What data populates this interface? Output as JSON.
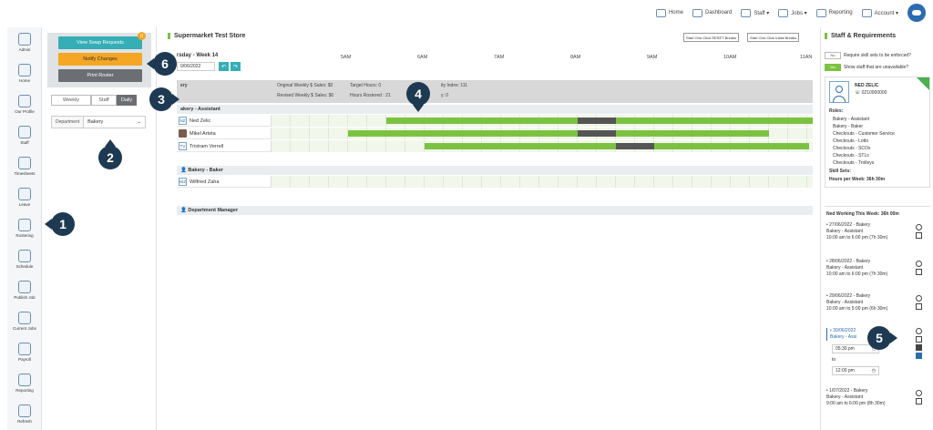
{
  "topnav": {
    "items": [
      {
        "label": "Home",
        "icon": "home-icon"
      },
      {
        "label": "Dashboard",
        "icon": "dashboard-icon"
      },
      {
        "label": "Staff ▾",
        "icon": "staff-icon"
      },
      {
        "label": "Jobs ▾",
        "icon": "jobs-icon"
      },
      {
        "label": "Reporting",
        "icon": "reporting-icon"
      },
      {
        "label": "Account ▾",
        "icon": "account-icon"
      }
    ]
  },
  "sidebar": {
    "items": [
      {
        "label": "Admin"
      },
      {
        "label": "Home"
      },
      {
        "label": "Our Profile"
      },
      {
        "label": "Staff"
      },
      {
        "label": "Timesheets"
      },
      {
        "label": "Leave"
      },
      {
        "label": "Rostering"
      },
      {
        "label": "Schedule"
      },
      {
        "label": "Publish Job"
      },
      {
        "label": "Current Jobs"
      },
      {
        "label": "Payroll"
      },
      {
        "label": "Reporting"
      },
      {
        "label": "Refresh"
      }
    ]
  },
  "panel": {
    "swap_label": "View Swap Requests",
    "swap_badge": "0",
    "notify_label": "Notify Changes",
    "print_label": "Print Roster",
    "views": {
      "weekly": "Weekly",
      "staff": "Staff",
      "daily": "Daily"
    },
    "department_label": "Department",
    "department_value": "Bakery"
  },
  "main": {
    "store_title": "Supermarket Test Store",
    "start_reset": "Start One-Click RESET Breaks",
    "start_initial": "Start One-Click Initial Breaks",
    "day_heading": "rsday - Week 14",
    "date_value": "0/06/2022",
    "times": [
      "5AM",
      "6AM",
      "7AM",
      "8AM",
      "9AM",
      "10AM",
      "11AN"
    ],
    "summary": {
      "dept": "ery",
      "orig": "Original Weekly $ Sales: $0",
      "rev": "Revised Weekly $ Sales: $0",
      "target": "Target Hours: 0",
      "rostered": "Hours Rostered : 21",
      "index": "ity Index: 111",
      "other": "y: 0"
    },
    "groups": [
      {
        "title": "akery - Assistant"
      },
      {
        "title": "Bakery - Baker"
      },
      {
        "title": "Department Manager"
      }
    ],
    "staff": [
      {
        "init": "NZ",
        "name": "Ned Zelic"
      },
      {
        "init": "",
        "name": "Mikel Arteta"
      },
      {
        "init": "TV",
        "name": "Tristram Verrell"
      },
      {
        "init": "WZ",
        "name": "Wilfried Zaha"
      }
    ]
  },
  "right": {
    "title": "Staff & Requirements",
    "toggle1_state": "No",
    "toggle1_label": "Require skill sets to be enforced?",
    "toggle2_state": "Yes",
    "toggle2_label": "Show staff that are unavailable?",
    "staff_name": "NED ZELIC",
    "staff_phone": "0210000000",
    "roles_heading": "Roles:",
    "roles": [
      "Bakery - Assistant",
      "Bakery - Baker",
      "Checkouts - Customer Service",
      "Checkouts - Lotto",
      "Checkouts - SCOs",
      "Checkouts - STLs",
      "Checkouts - Trolleys"
    ],
    "skill_sets": "Skill Sets:",
    "hours_per_week": "Hours per Week: 36h 30m",
    "working_title": "Ned Working This Week: 36h 00m",
    "shifts": [
      {
        "date": "• 27/06/2022 - Bakery",
        "role": "Bakery - Assistant",
        "time": "10:00 am to 6:00 pm (7h 30m)"
      },
      {
        "date": "• 28/06/2022 - Bakery",
        "role": "Bakery - Assistant",
        "time": "10:00 am to 6:00 pm (7h 30m)"
      },
      {
        "date": "• 29/06/2022 - Bakery",
        "role": "Bakery - Assistant",
        "time": "10:00 am to 5:00 pm (6h 30m)"
      },
      {
        "date": "• 30/06/2022",
        "role": "Bakery - Assi",
        "time": ""
      },
      {
        "date": "• 1/07/2022 - Bakery",
        "role": "Bakery - Assistant",
        "time": "9:00 am to 6:00 pm (8h 30m)"
      }
    ],
    "edit_start": "05:30 pm",
    "edit_to": "to",
    "edit_end": "12:00 pm"
  },
  "callouts": [
    "1",
    "2",
    "3",
    "4",
    "5",
    "6"
  ]
}
